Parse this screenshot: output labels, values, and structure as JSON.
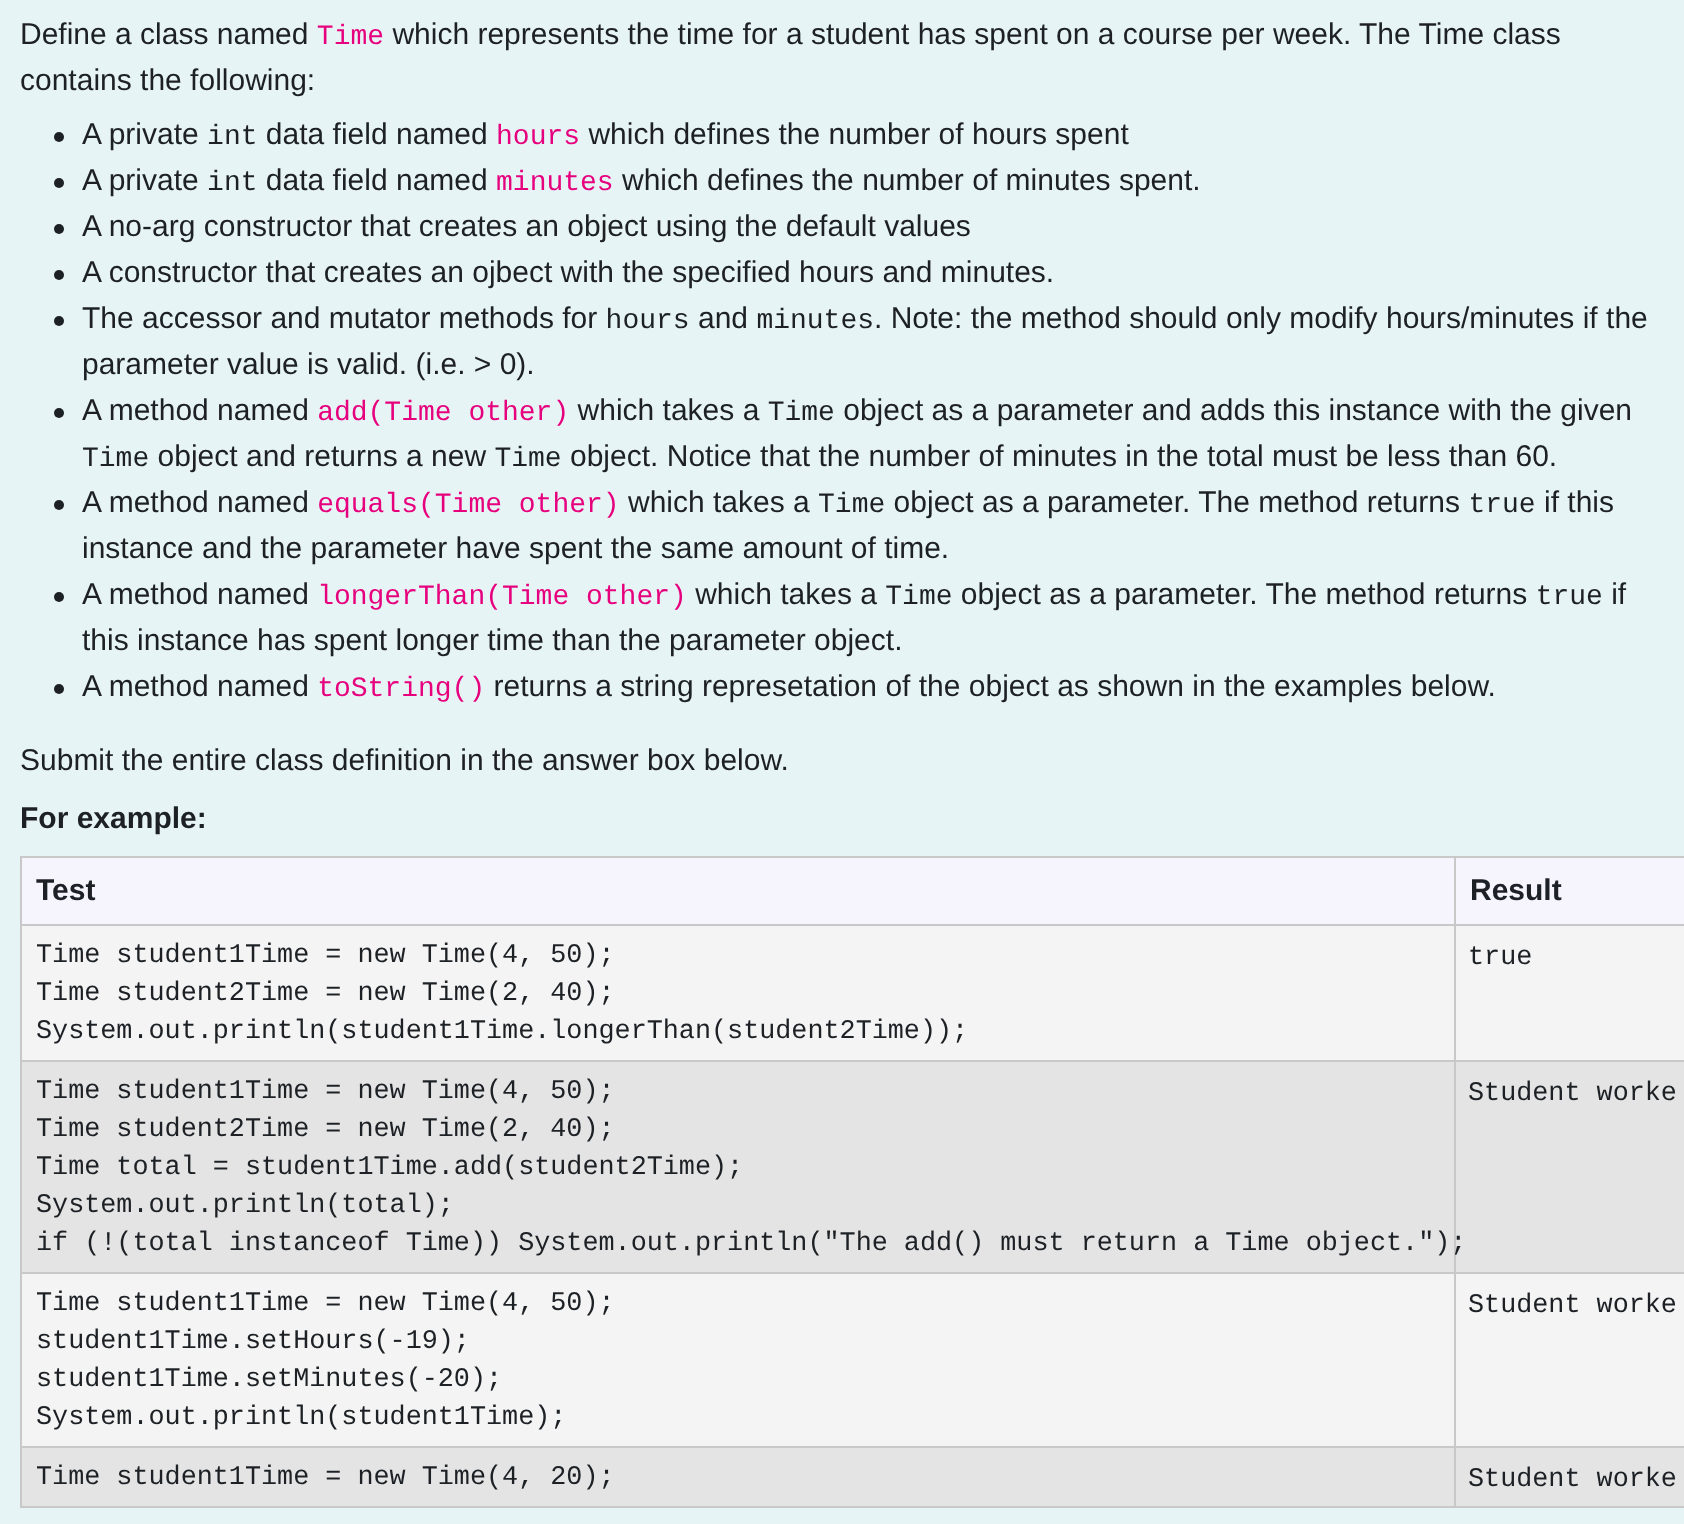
{
  "intro": [
    {
      "kind": "text",
      "text": "Define a class named "
    },
    {
      "kind": "name",
      "text": "Time"
    },
    {
      "kind": "text",
      "text": " which represents the time for a student has spent on a course per week. The Time class contains the following:"
    }
  ],
  "bullets": [
    [
      {
        "kind": "text",
        "text": "A private "
      },
      {
        "kind": "code",
        "text": "int"
      },
      {
        "kind": "text",
        "text": " data field named "
      },
      {
        "kind": "name",
        "text": "hours"
      },
      {
        "kind": "text",
        "text": " which defines the number of hours spent"
      }
    ],
    [
      {
        "kind": "text",
        "text": "A private "
      },
      {
        "kind": "code",
        "text": "int"
      },
      {
        "kind": "text",
        "text": " data field named "
      },
      {
        "kind": "name",
        "text": "minutes"
      },
      {
        "kind": "text",
        "text": " which defines the number of minutes spent."
      }
    ],
    [
      {
        "kind": "text",
        "text": "A no-arg constructor that creates an object using the default values"
      }
    ],
    [
      {
        "kind": "text",
        "text": "A constructor that creates an ojbect with the specified hours and minutes."
      }
    ],
    [
      {
        "kind": "text",
        "text": "The accessor and mutator methods for "
      },
      {
        "kind": "code",
        "text": "hours"
      },
      {
        "kind": "text",
        "text": " and "
      },
      {
        "kind": "code",
        "text": "minutes"
      },
      {
        "kind": "text",
        "text": ". Note: the method should only modify hours/minutes if the parameter value is valid. (i.e. > 0)."
      }
    ],
    [
      {
        "kind": "text",
        "text": "A method named "
      },
      {
        "kind": "name",
        "text": "add(Time other)"
      },
      {
        "kind": "text",
        "text": " which takes a "
      },
      {
        "kind": "code",
        "text": "Time"
      },
      {
        "kind": "text",
        "text": " object as a parameter and adds this instance with the given "
      },
      {
        "kind": "code",
        "text": "Time"
      },
      {
        "kind": "text",
        "text": " object and returns a new "
      },
      {
        "kind": "code",
        "text": "Time"
      },
      {
        "kind": "text",
        "text": " object. Notice that the number of minutes in the total must be less than 60."
      }
    ],
    [
      {
        "kind": "text",
        "text": "A method named "
      },
      {
        "kind": "name",
        "text": "equals(Time other)"
      },
      {
        "kind": "text",
        "text": " which takes a "
      },
      {
        "kind": "code",
        "text": "Time"
      },
      {
        "kind": "text",
        "text": " object as a parameter. The method returns "
      },
      {
        "kind": "code",
        "text": "true"
      },
      {
        "kind": "text",
        "text": " if this instance and the parameter have spent the same amount of time."
      }
    ],
    [
      {
        "kind": "text",
        "text": "A method named "
      },
      {
        "kind": "name",
        "text": "longerThan(Time other)"
      },
      {
        "kind": "text",
        "text": " which takes a "
      },
      {
        "kind": "code",
        "text": "Time"
      },
      {
        "kind": "text",
        "text": " object as a parameter. The method returns "
      },
      {
        "kind": "code",
        "text": "true"
      },
      {
        "kind": "text",
        "text": " if this instance has spent longer time than the parameter object."
      }
    ],
    [
      {
        "kind": "text",
        "text": "A method named "
      },
      {
        "kind": "name",
        "text": "toString()"
      },
      {
        "kind": "text",
        "text": " returns a string represetation of the object as shown in the examples below."
      }
    ]
  ],
  "submit_note": "Submit the entire class definition in the answer box below.",
  "example_heading": "For example:",
  "table": {
    "columns": [
      "Test",
      "Result"
    ],
    "rows": [
      {
        "test": [
          "Time student1Time = new Time(4, 50);",
          "Time student2Time = new Time(2, 40);",
          "System.out.println(student1Time.longerThan(student2Time));"
        ],
        "result": "true"
      },
      {
        "test": [
          "Time student1Time = new Time(4, 50);",
          "Time student2Time = new Time(2, 40);",
          "Time total = student1Time.add(student2Time);",
          "System.out.println(total);",
          "if (!(total instanceof Time)) System.out.println(\"The add() must return a Time object.\");"
        ],
        "result": "Student worke"
      },
      {
        "test": [
          "Time student1Time = new Time(4, 50);",
          "student1Time.setHours(-19);",
          "student1Time.setMinutes(-20);",
          "System.out.println(student1Time);"
        ],
        "result": "Student worke"
      },
      {
        "test": [
          "Time student1Time = new Time(4, 20);"
        ],
        "result": "Student worke"
      }
    ]
  }
}
